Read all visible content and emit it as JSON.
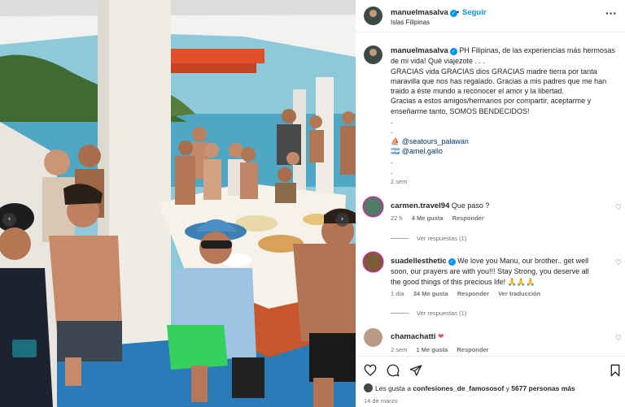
{
  "post_header": {
    "username": "manuelmasalva",
    "separator": "•",
    "follow_label": "Seguir",
    "location": "Islas Filipinas",
    "more_icon": "more-horizontal-icon"
  },
  "photo": {
    "description_icon": "group-photo-on-boat",
    "prev_icon": "chevron-left-icon",
    "next_icon": "chevron-right-icon",
    "prev_glyph": "‹",
    "next_glyph": "›"
  },
  "caption": {
    "username": "manuelmasalva",
    "lines": [
      "PH Filipinas, de las experiencias más hermosas",
      "de mi vida! Qué viajezote . . .",
      "GRACIAS vida GRACIAS dios GRACIAS madre tierra por tanta",
      "maravilla que nos has regalado. Gracias a mis padres que me han",
      "traido a éste mundo a reconocer el amor y la libertad.",
      "Gracias a estos amigos/hermanos por compartir, aceptarme y",
      "enseñarme tanto, SOMOS BENDECIDOS!"
    ],
    "dots": [
      ".",
      "."
    ],
    "mention_1": "@seatours_palawan",
    "mention_2": "@amel.gallo",
    "trailing_dots": [
      ".",
      ".",
      "."
    ],
    "time": "2 sem"
  },
  "comments": [
    {
      "username": "carmen.travel94",
      "lines": [
        "Que paso ?"
      ],
      "time": "22 h",
      "likes": "4 Me gusta",
      "reply": "Responder",
      "view_replies": "Ver respuestas (1)"
    },
    {
      "username": "suadellesthetic",
      "lines": [
        "We love you Manu, our brother.. get well",
        "soon, our prayers are with you!!! Stay Strong, you deserve all",
        "the good things of this precious life! 🙏🙏🙏"
      ],
      "time": "1 día",
      "likes": "34 Me gusta",
      "reply": "Responder",
      "translate": "Ver traducción",
      "view_replies": "Ver respuestas (1)"
    },
    {
      "username": "chamachatti",
      "lines": [
        "❤"
      ],
      "time": "2 sem",
      "likes": "1 Me gusta",
      "reply": "Responder"
    }
  ],
  "actions": {
    "like_icon": "heart-icon",
    "comment_icon": "comment-icon",
    "share_icon": "send-icon",
    "save_icon": "bookmark-icon"
  },
  "likes_summary": {
    "prefix": "Les gusta a",
    "user": "confesiones_de_famososof",
    "connector": "y",
    "count": "5677 personas más"
  },
  "post_date": "14 de marzo",
  "colors": {
    "accent": "#0095f6",
    "text": "#262626",
    "secondary": "#737373",
    "like_red": "#ed4956"
  }
}
